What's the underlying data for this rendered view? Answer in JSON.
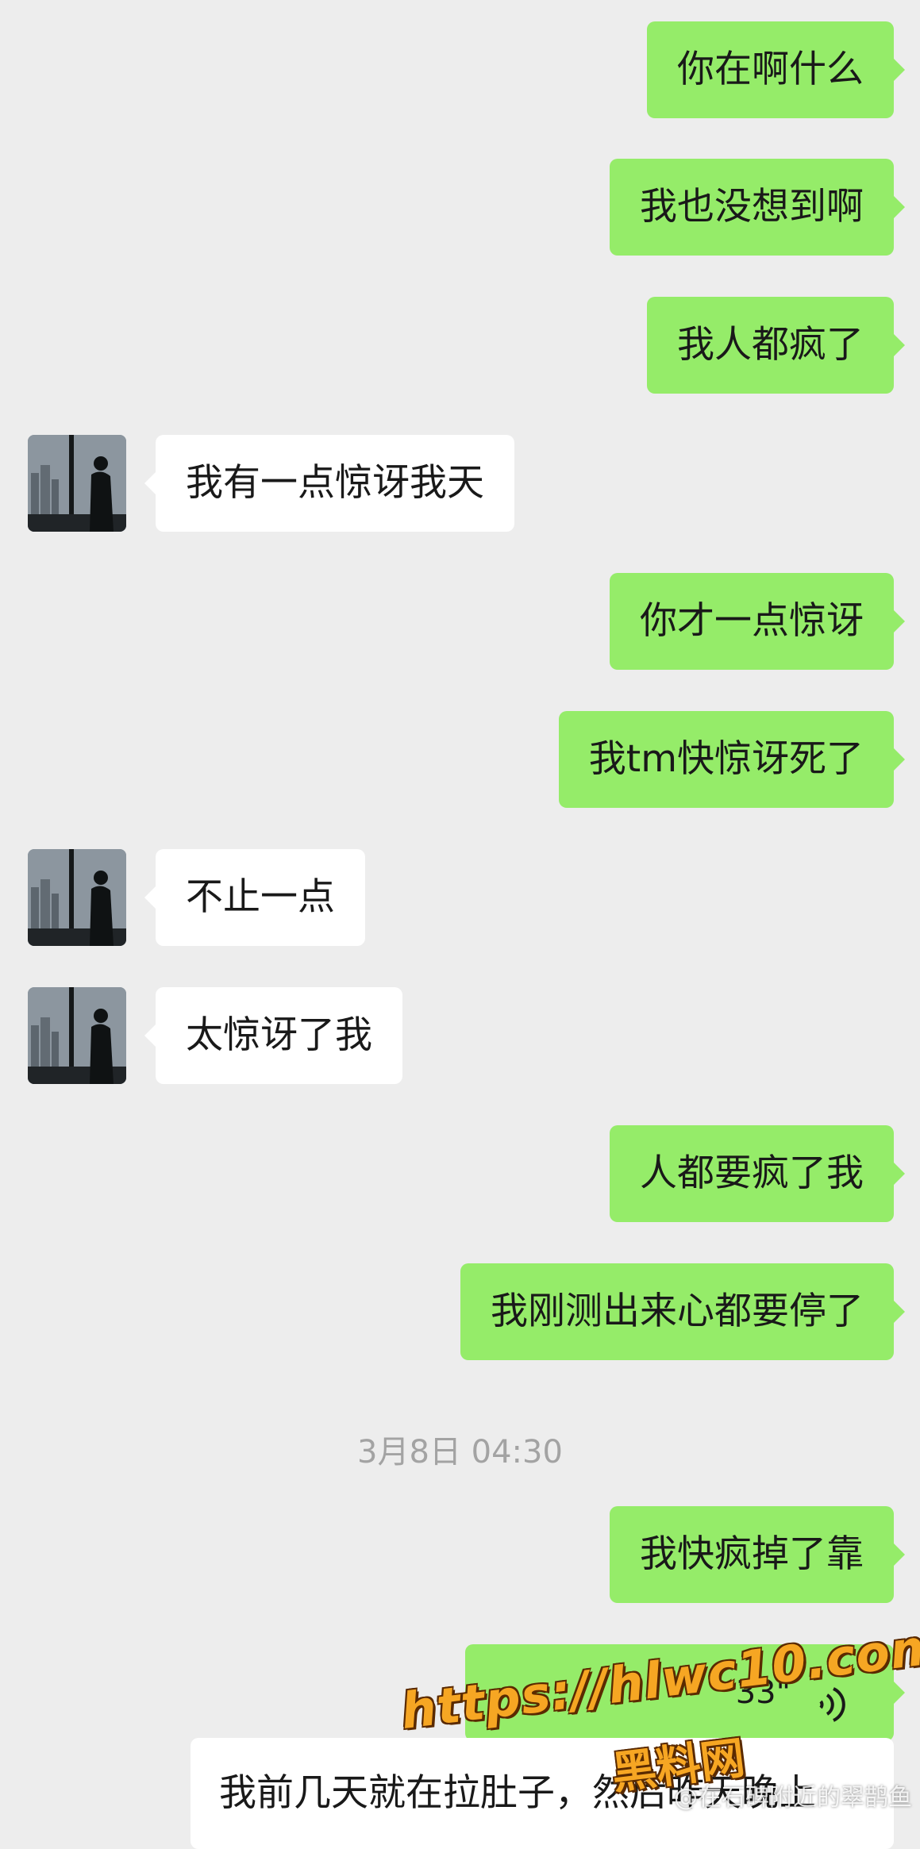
{
  "messages": [
    {
      "side": "me",
      "text": "你在啊什么"
    },
    {
      "side": "me",
      "text": "我也没想到啊"
    },
    {
      "side": "me",
      "text": "我人都疯了"
    },
    {
      "side": "them",
      "text": "我有一点惊讶我天"
    },
    {
      "side": "me",
      "text": "你才一点惊讶"
    },
    {
      "side": "me",
      "text": "我tm快惊讶死了"
    },
    {
      "side": "them",
      "text": "不止一点"
    },
    {
      "side": "them",
      "text": "太惊讶了我"
    },
    {
      "side": "me",
      "text": "人都要疯了我"
    },
    {
      "side": "me",
      "text": "我刚测出来心都要停了"
    },
    {
      "side": "me",
      "text": "我快疯掉了靠"
    }
  ],
  "timestamp": "3月8日 04:30",
  "voice_message": {
    "duration": "33\"",
    "icon": "voice-wave-icon"
  },
  "partial_message": "我前几天就在拉肚子，然后昨天晚上",
  "watermark": {
    "url": "https://hlwc10.com",
    "site_name": "黑料网",
    "handle": "@在石碑附近的翠鹊鱼"
  },
  "colors": {
    "background": "#ededed",
    "my_bubble": "#95ec69",
    "their_bubble": "#ffffff"
  }
}
